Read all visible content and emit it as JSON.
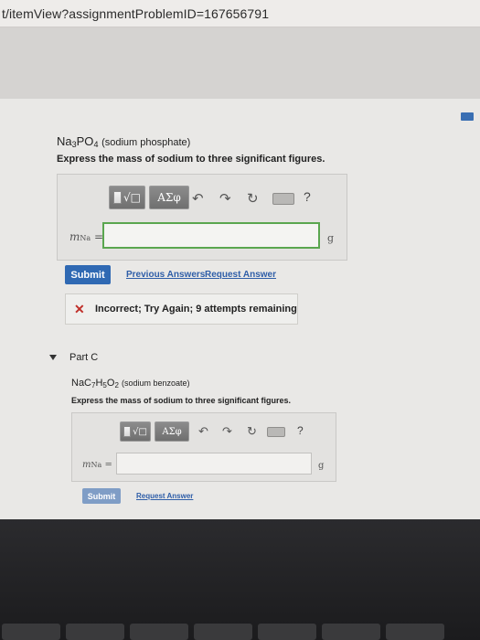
{
  "browser": {
    "url": "t/itemView?assignmentProblemID=167656791"
  },
  "part_b": {
    "compound_base": "Na",
    "compound_sub1": "3",
    "compound_mid": "PO",
    "compound_sub2": "4",
    "compound_name": "(sodium phosphate)",
    "instruction": "Express the mass of sodium to three significant figures.",
    "toolbar": {
      "templates_label": "√□",
      "greek_label": "ΑΣφ",
      "help": "?"
    },
    "answer_label_var": "m",
    "answer_label_sub": "Na",
    "answer_label_eq": " =",
    "answer_value": "",
    "unit": "g",
    "submit_label": "Submit",
    "previous_answers_label": "Previous Answers",
    "request_answer_label": "Request Answer",
    "feedback": {
      "icon": "✕",
      "text": "Incorrect; Try Again; 9 attempts remaining"
    }
  },
  "part_c": {
    "heading": "Part C",
    "compound_base": "NaC",
    "compound_sub1": "7",
    "compound_mid1": "H",
    "compound_sub2": "5",
    "compound_mid2": "O",
    "compound_sub3": "2",
    "compound_name": "(sodium benzoate)",
    "instruction": "Express the mass of sodium to three significant figures.",
    "toolbar": {
      "templates_label": "√□",
      "greek_label": "ΑΣφ",
      "help": "?"
    },
    "answer_label_var": "m",
    "answer_label_sub": "Na",
    "answer_label_eq": " =",
    "answer_value": "",
    "unit": "g",
    "submit_label": "Submit",
    "request_answer_label": "Request Answer"
  },
  "icons": {
    "undo": "↶",
    "redo": "↷",
    "reset": "↻"
  }
}
